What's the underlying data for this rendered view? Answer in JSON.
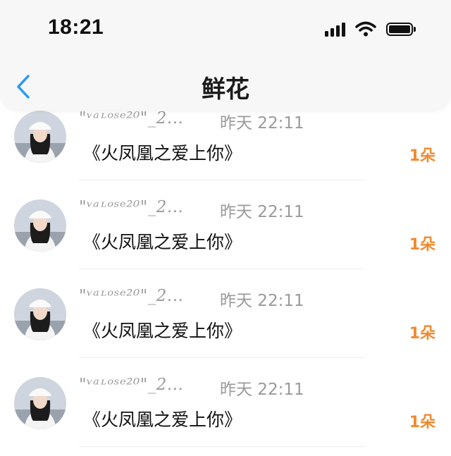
{
  "status_bar": {
    "time": "18:21"
  },
  "header": {
    "title": "鲜花"
  },
  "items": [
    {
      "name": "\"ᵛᵃᶫᵒˢᵉ²⁰\"_2...",
      "time": "昨天 22:11",
      "gift": "《火凤凰之爱上你》",
      "count": "1朵"
    },
    {
      "name": "\"ᵛᵃᶫᵒˢᵉ²⁰\"_2...",
      "time": "昨天 22:11",
      "gift": "《火凤凰之爱上你》",
      "count": "1朵"
    },
    {
      "name": "\"ᵛᵃᶫᵒˢᵉ²⁰\"_2...",
      "time": "昨天 22:11",
      "gift": "《火凤凰之爱上你》",
      "count": "1朵"
    },
    {
      "name": "\"ᵛᵃᶫᵒˢᵉ²⁰\"_2...",
      "time": "昨天 22:11",
      "gift": "《火凤凰之爱上你》",
      "count": "1朵"
    }
  ],
  "colors": {
    "accent": "#2d9cf0",
    "count": "#f08a30",
    "meta": "#9a9a9a"
  },
  "icons": {
    "back": "chevron-left-icon",
    "signal": "signal-icon",
    "wifi": "wifi-icon",
    "battery": "battery-icon"
  }
}
